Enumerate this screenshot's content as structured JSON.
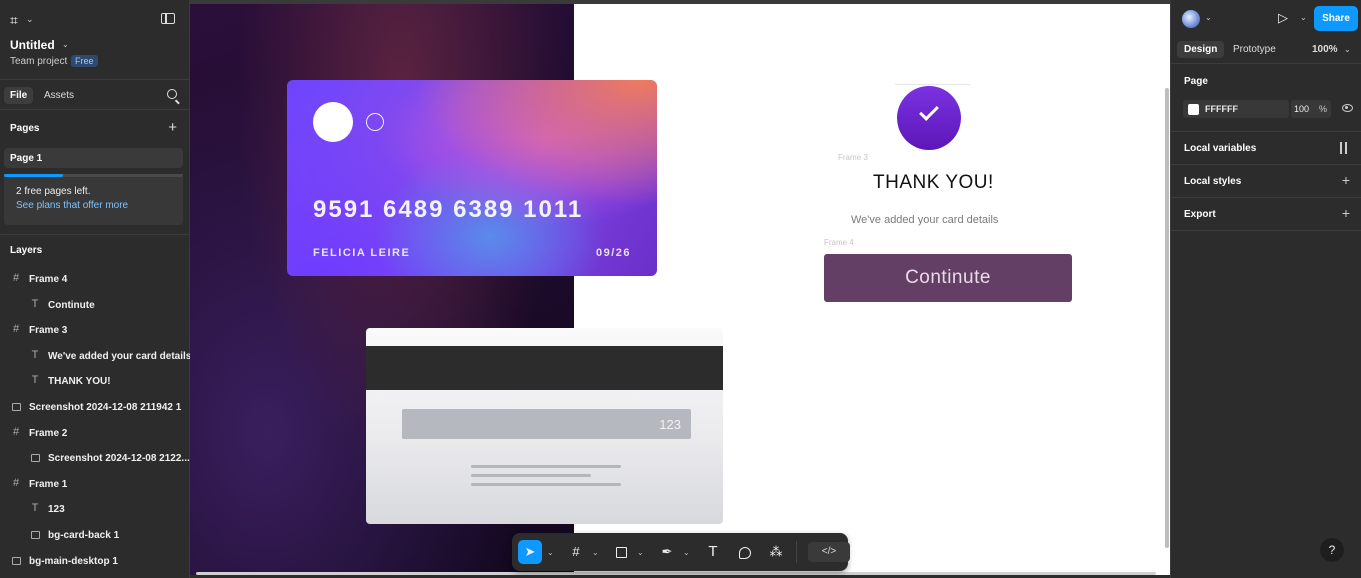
{
  "left_panel": {
    "doc_title": "Untitled",
    "team": "Team project",
    "plan_badge": "Free",
    "tabs": {
      "file": "File",
      "assets": "Assets"
    },
    "pages_header": "Pages",
    "pages": [
      {
        "label": "Page 1"
      }
    ],
    "free_pages": {
      "text": "2 free pages left.",
      "link": "See plans that offer more",
      "progress": 0.33
    },
    "layers_header": "Layers",
    "layers": [
      {
        "label": "Frame 4",
        "icon": "frame-icon",
        "level": 0
      },
      {
        "label": "Continute",
        "icon": "text-icon",
        "level": 1
      },
      {
        "label": "Frame 3",
        "icon": "frame-icon",
        "level": 0
      },
      {
        "label": "We've added your card details",
        "icon": "text-icon",
        "level": 1
      },
      {
        "label": "THANK YOU!",
        "icon": "text-icon",
        "level": 1
      },
      {
        "label": "Screenshot 2024-12-08 211942 1",
        "icon": "image-icon",
        "level": 0
      },
      {
        "label": "Frame 2",
        "icon": "frame-icon",
        "level": 0
      },
      {
        "label": "Screenshot 2024-12-08 2122...",
        "icon": "image-icon",
        "level": 1
      },
      {
        "label": "Frame 1",
        "icon": "frame-icon",
        "level": 0
      },
      {
        "label": "123",
        "icon": "text-icon",
        "level": 1
      },
      {
        "label": "bg-card-back 1",
        "icon": "image-icon",
        "level": 1
      },
      {
        "label": "bg-main-desktop 1",
        "icon": "image-icon",
        "level": 0
      }
    ]
  },
  "canvas": {
    "frame_labels": {
      "frame3": "Frame 3",
      "frame4": "Frame 4"
    },
    "card_front": {
      "number": "9591 6489 6389 1011",
      "name": "FELICIA LEIRE",
      "expiry": "09/26"
    },
    "card_back": {
      "cvc": "123"
    },
    "thank_you": "THANK YOU!",
    "added_text": "We've added your card details",
    "continue_label": "Continute",
    "accent_purple": "#633f65"
  },
  "toolbar": {
    "tools": [
      "move-tool",
      "frame-tool",
      "rectangle-tool",
      "pen-tool",
      "text-tool",
      "comment-tool",
      "actions-tool",
      "dev-mode-toggle"
    ]
  },
  "right_panel": {
    "share_label": "Share",
    "tabs": {
      "design": "Design",
      "prototype": "Prototype"
    },
    "zoom": "100%",
    "page_section": "Page",
    "page_color": "FFFFFF",
    "page_opacity": "100",
    "opacity_unit": "%",
    "local_variables": "Local variables",
    "local_styles": "Local styles",
    "export": "Export",
    "help_label": "?",
    "brand_blue": "#0d99ff"
  }
}
